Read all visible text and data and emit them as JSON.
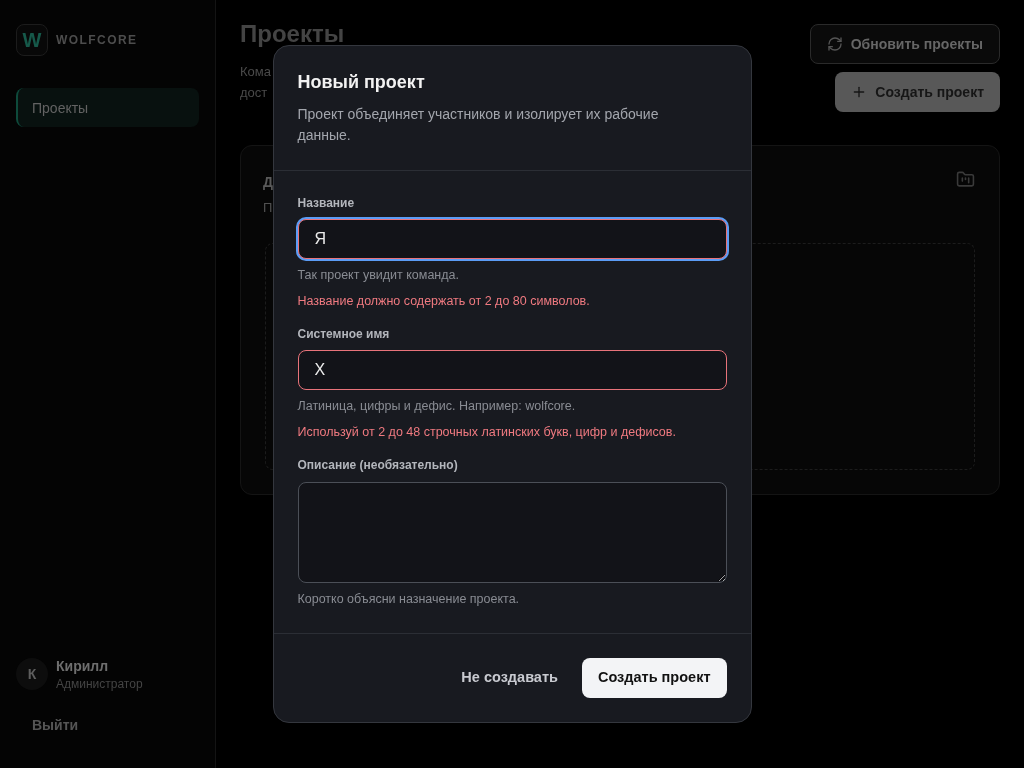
{
  "sidebar": {
    "logo": {
      "mark": "W",
      "name": "WOLFCORE"
    },
    "nav_items": [
      {
        "label": "Проекты",
        "selected": true
      }
    ],
    "user": {
      "initial": "К",
      "name": "Кирилл",
      "role": "Администратор"
    },
    "logout": "Выйти"
  },
  "page": {
    "title": "Проекты",
    "description_lines": [
      "Кома",
      "дост"
    ],
    "buttons": [
      {
        "kind": "refresh",
        "label": "Обновить проекты"
      },
      {
        "kind": "create",
        "label": "Создать проект"
      }
    ],
    "card": {
      "title": "Д",
      "subtitle": "П"
    }
  },
  "dialog": {
    "title": "Новый проект",
    "description": "Проект объединяет участников и изолирует их рабочие данные.",
    "fields": [
      {
        "kind": "input",
        "label": "Название",
        "value": "Я",
        "hint": "Так проект увидит команда.",
        "error": "Название должно содержать от 2 до 80 символов.",
        "focused": true
      },
      {
        "kind": "input",
        "label": "Системное имя",
        "value": "X",
        "hint": "Латиница, цифры и дефис. Например: wolfcore.",
        "error": "Используй от 2 до 48 строчных латинских букв, цифр и дефисов.",
        "focused": false
      },
      {
        "kind": "textarea",
        "label": "Описание (необязательно)",
        "hint": "Коротко объясни назначение проекта.",
        "focused": false
      }
    ],
    "buttons": [
      {
        "kind": "secondary",
        "label": "Не создавать"
      },
      {
        "kind": "primary",
        "label": "Создать проект"
      }
    ]
  }
}
